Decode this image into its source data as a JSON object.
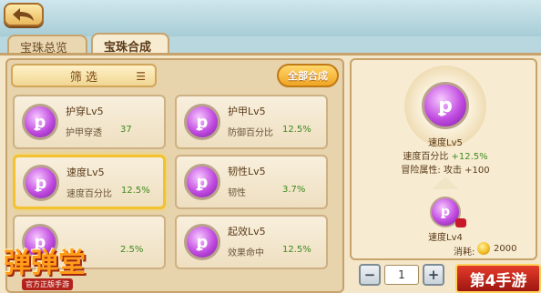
{
  "tabs": [
    {
      "label": "宝珠总览"
    },
    {
      "label": "宝珠合成"
    }
  ],
  "list": {
    "filter_label": "筛 选",
    "all_combine_label": "全部合成",
    "cards": [
      {
        "name": "护穿Lv5",
        "attr": "护甲穿透",
        "value": "37",
        "icon": "gem-icon"
      },
      {
        "name": "护甲Lv5",
        "attr": "防御百分比",
        "value": "12.5%",
        "icon": "gem-icon"
      },
      {
        "name": "速度Lv5",
        "attr": "速度百分比",
        "value": "12.5%",
        "icon": "gem-icon"
      },
      {
        "name": "韧性Lv5",
        "attr": "韧性",
        "value": "3.7%",
        "icon": "gem-icon"
      },
      {
        "name": "",
        "attr": "",
        "value": "2.5%",
        "icon": "gem-icon"
      },
      {
        "name": "起效Lv5",
        "attr": "效果命中",
        "value": "12.5%",
        "icon": "gem-icon"
      }
    ]
  },
  "detail": {
    "name": "速度Lv5",
    "attr_label": "速度百分比",
    "attr_value": "+12.5%",
    "adventure": "冒险属性: 攻击 +100",
    "source_name": "速度Lv4",
    "cost_label": "消耗:",
    "cost_value": "2000"
  },
  "quantity": {
    "minus": "−",
    "value": "1",
    "plus": "+"
  },
  "branding": {
    "logo_left": "弹弹堂",
    "logo_left_sub": "官方正版手游",
    "logo_right": "第4手游"
  }
}
